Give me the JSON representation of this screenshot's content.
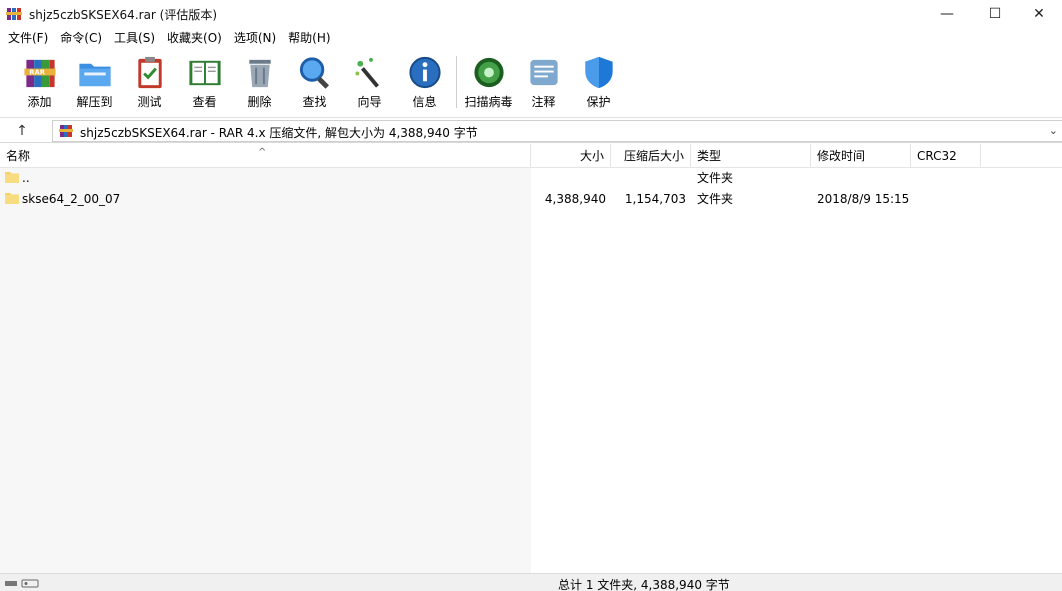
{
  "window": {
    "title": "shjz5czbSKSEX64.rar (评估版本)",
    "minimize_glyph": "—",
    "maximize_glyph": "☐",
    "close_glyph": "✕"
  },
  "menu": [
    "文件(F)",
    "命令(C)",
    "工具(S)",
    "收藏夹(O)",
    "选项(N)",
    "帮助(H)"
  ],
  "toolbar": {
    "add": "添加",
    "extract": "解压到",
    "test": "测试",
    "view": "查看",
    "delete": "删除",
    "find": "查找",
    "wizard": "向导",
    "info": "信息",
    "virusscan": "扫描病毒",
    "comment": "注释",
    "protect": "保护"
  },
  "address": {
    "up_glyph": "↑",
    "path": "shjz5czbSKSEX64.rar - RAR 4.x 压缩文件, 解包大小为 4,388,940 字节",
    "dropdown_glyph": "⌄"
  },
  "columns": {
    "name": "名称",
    "size": "大小",
    "packed": "压缩后大小",
    "type": "类型",
    "modified": "修改时间",
    "crc": "CRC32",
    "sort_glyph": "^"
  },
  "rows": [
    {
      "name": "..",
      "size": "",
      "packed": "",
      "type": "文件夹",
      "modified": ""
    },
    {
      "name": "skse64_2_00_07",
      "size": "4,388,940",
      "packed": "1,154,703",
      "type": "文件夹",
      "modified": "2018/8/9 15:15"
    }
  ],
  "status": {
    "text": "总计 1 文件夹, 4,388,940 字节"
  },
  "colors": {
    "folder": "#f5d36b",
    "accent_blue": "#1e78d7"
  }
}
